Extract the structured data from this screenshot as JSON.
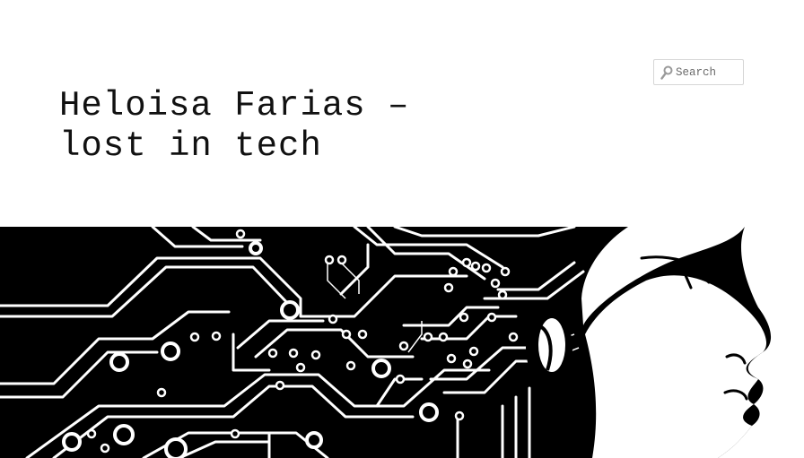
{
  "site": {
    "title_line1": "Heloisa Farias –",
    "title_line2": "lost in tech"
  },
  "search": {
    "placeholder": "Search",
    "value": ""
  },
  "icons": {
    "search": "magnifier-icon"
  },
  "colors": {
    "background": "#ffffff",
    "text": "#111111",
    "banner_bg": "#000000",
    "banner_fg": "#ffffff",
    "input_border": "#d6d6d6"
  }
}
